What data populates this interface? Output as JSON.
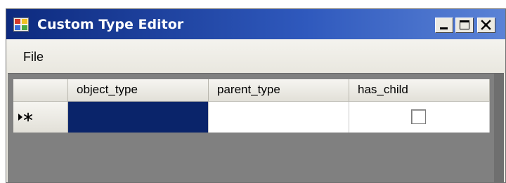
{
  "window": {
    "title": "Custom Type Editor"
  },
  "menu": {
    "items": [
      {
        "label": "File"
      }
    ]
  },
  "grid": {
    "columns": [
      {
        "label": "object_type"
      },
      {
        "label": "parent_type"
      },
      {
        "label": "has_child"
      }
    ],
    "new_row": {
      "object_type": "",
      "parent_type": "",
      "has_child": false
    },
    "row_header_icon": "current-new-row-indicator-icon"
  },
  "icons": {
    "app": "app-icon",
    "minimize": "minimize-icon",
    "maximize": "maximize-icon",
    "close": "close-icon"
  },
  "colors": {
    "titlebar_start": "#0d2a7e",
    "titlebar_end": "#5b83d6",
    "selection": "#0a246a",
    "grid_background": "#808080"
  }
}
